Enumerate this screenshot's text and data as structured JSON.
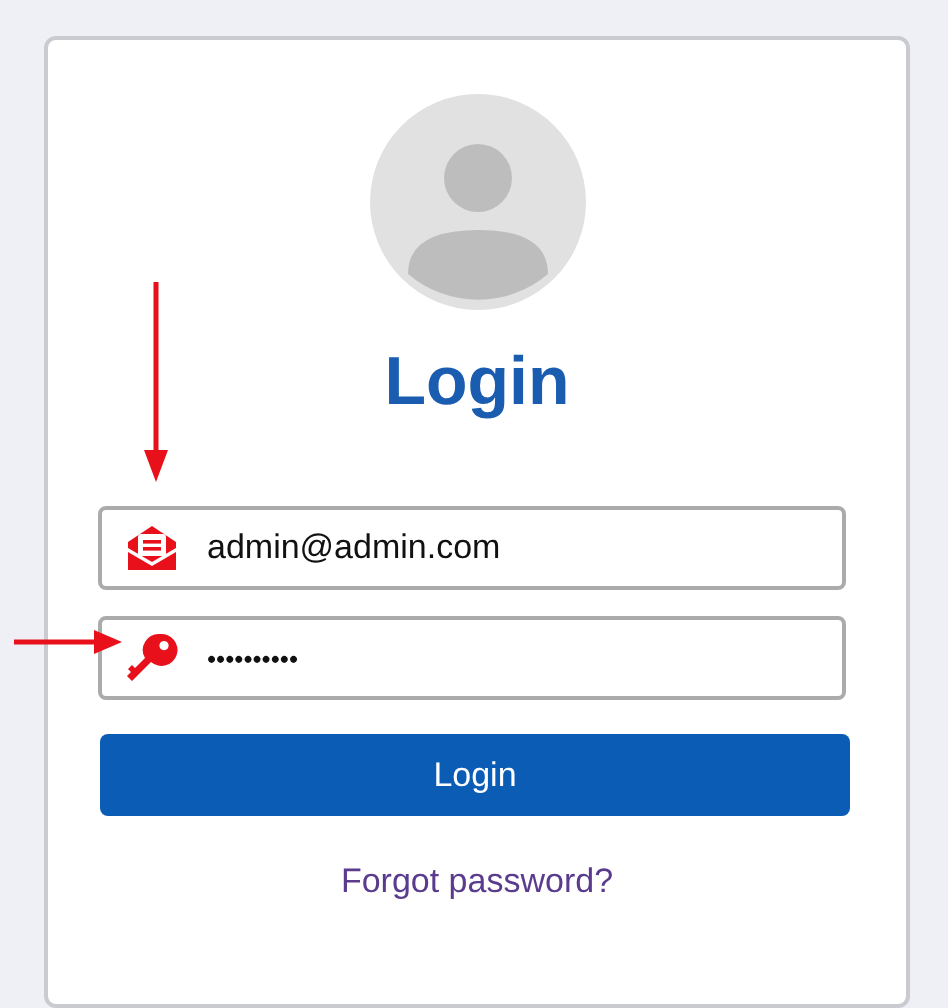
{
  "title": "Login",
  "fields": [
    {
      "kind": "email",
      "value": "admin@admin.com"
    },
    {
      "kind": "password",
      "value": "••••••••••"
    }
  ],
  "button": "Login",
  "link": "Forgot password?"
}
